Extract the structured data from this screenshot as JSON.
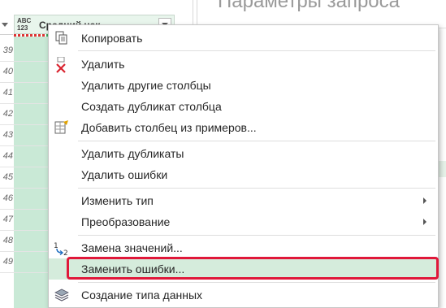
{
  "grid": {
    "column_type_badge": "ABC\n123",
    "column_title": "Средний чек",
    "row_numbers": [
      "39",
      "40",
      "41",
      "42",
      "43",
      "44",
      "45",
      "46",
      "47",
      "48",
      "49"
    ]
  },
  "pane": {
    "title": "Параметры запроса"
  },
  "menu": {
    "items": [
      {
        "label": "Копировать",
        "icon": "copy-icon"
      },
      {
        "label": "Удалить",
        "icon": "delete-column-icon"
      },
      {
        "label": "Удалить другие столбцы"
      },
      {
        "label": "Создать дубликат столбца"
      },
      {
        "label": "Добавить столбец из примеров...",
        "icon": "column-from-examples-icon"
      },
      {
        "label": "Удалить дубликаты"
      },
      {
        "label": "Удалить ошибки"
      },
      {
        "label": "Изменить тип",
        "submenu": true
      },
      {
        "label": "Преобразование",
        "submenu": true
      },
      {
        "label": "Замена значений...",
        "icon": "replace-values-icon"
      },
      {
        "label": "Заменить ошибки...",
        "highlighted": true
      },
      {
        "label": "Создание типа данных",
        "icon": "data-type-icon"
      }
    ],
    "highlight_color": "#e0183a",
    "hover_color": "#d5ecdc"
  }
}
